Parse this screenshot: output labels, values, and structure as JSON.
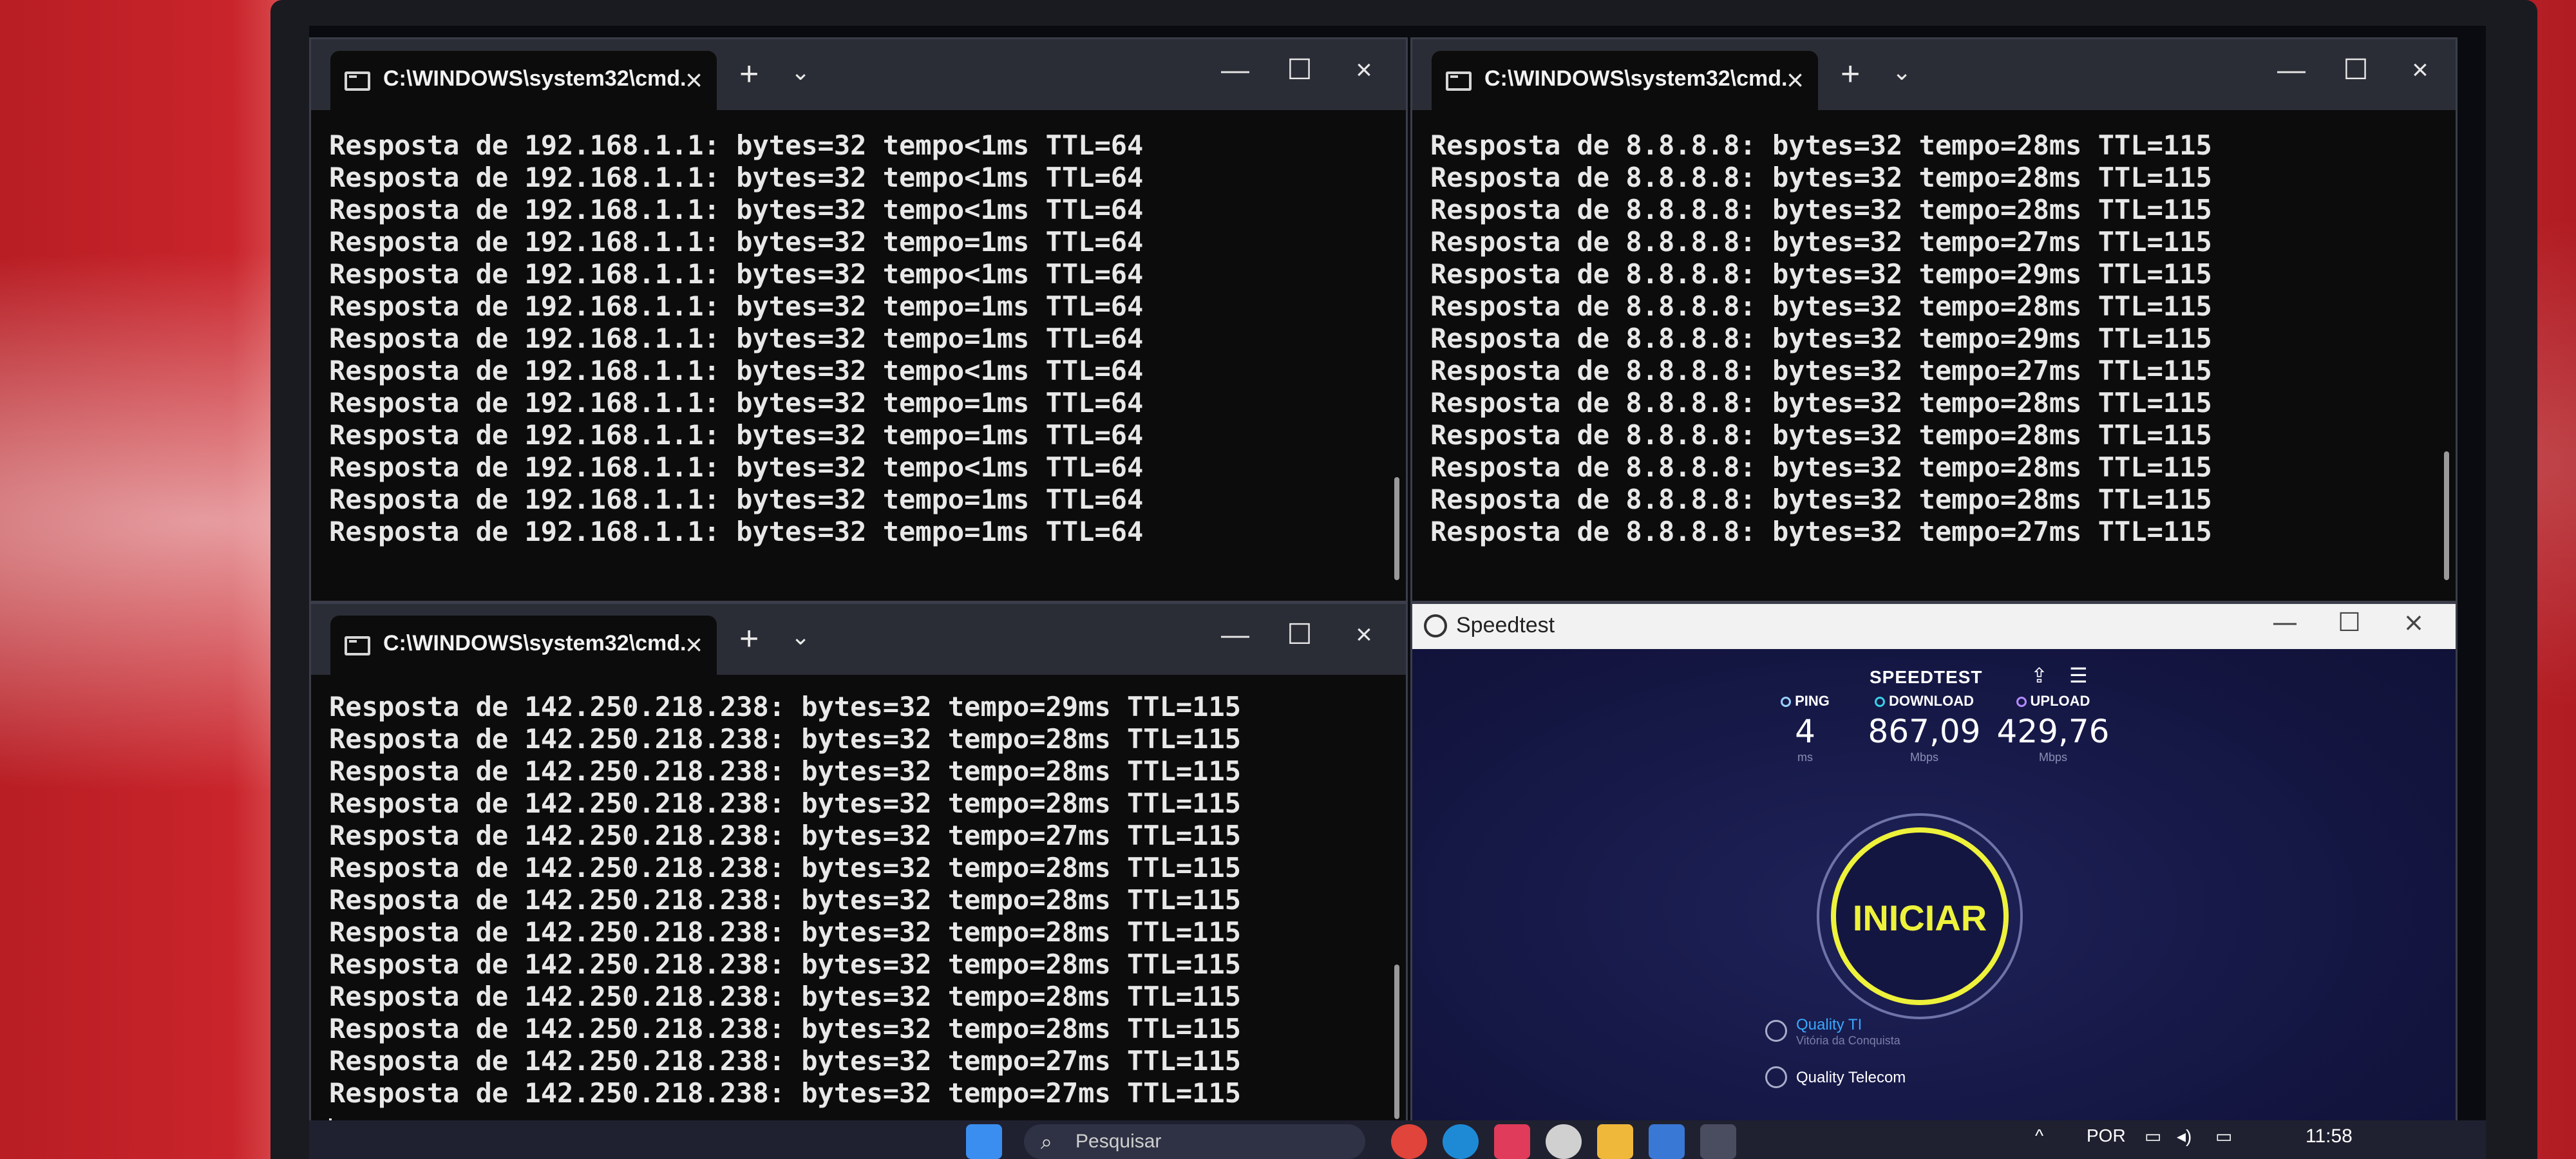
{
  "terminal_top_left": {
    "tab_title": "C:\\WINDOWS\\system32\\cmd.",
    "lines": [
      "Resposta de 192.168.1.1: bytes=32 tempo<1ms TTL=64",
      "Resposta de 192.168.1.1: bytes=32 tempo<1ms TTL=64",
      "Resposta de 192.168.1.1: bytes=32 tempo<1ms TTL=64",
      "Resposta de 192.168.1.1: bytes=32 tempo=1ms TTL=64",
      "Resposta de 192.168.1.1: bytes=32 tempo<1ms TTL=64",
      "Resposta de 192.168.1.1: bytes=32 tempo=1ms TTL=64",
      "Resposta de 192.168.1.1: bytes=32 tempo=1ms TTL=64",
      "Resposta de 192.168.1.1: bytes=32 tempo<1ms TTL=64",
      "Resposta de 192.168.1.1: bytes=32 tempo=1ms TTL=64",
      "Resposta de 192.168.1.1: bytes=32 tempo=1ms TTL=64",
      "Resposta de 192.168.1.1: bytes=32 tempo<1ms TTL=64",
      "Resposta de 192.168.1.1: bytes=32 tempo=1ms TTL=64",
      "Resposta de 192.168.1.1: bytes=32 tempo=1ms TTL=64"
    ]
  },
  "terminal_top_right": {
    "tab_title": "C:\\WINDOWS\\system32\\cmd.",
    "lines": [
      "Resposta de 8.8.8.8: bytes=32 tempo=28ms TTL=115",
      "Resposta de 8.8.8.8: bytes=32 tempo=28ms TTL=115",
      "Resposta de 8.8.8.8: bytes=32 tempo=28ms TTL=115",
      "Resposta de 8.8.8.8: bytes=32 tempo=27ms TTL=115",
      "Resposta de 8.8.8.8: bytes=32 tempo=29ms TTL=115",
      "Resposta de 8.8.8.8: bytes=32 tempo=28ms TTL=115",
      "Resposta de 8.8.8.8: bytes=32 tempo=29ms TTL=115",
      "Resposta de 8.8.8.8: bytes=32 tempo=27ms TTL=115",
      "Resposta de 8.8.8.8: bytes=32 tempo=28ms TTL=115",
      "Resposta de 8.8.8.8: bytes=32 tempo=28ms TTL=115",
      "Resposta de 8.8.8.8: bytes=32 tempo=28ms TTL=115",
      "Resposta de 8.8.8.8: bytes=32 tempo=28ms TTL=115",
      "Resposta de 8.8.8.8: bytes=32 tempo=27ms TTL=115"
    ]
  },
  "terminal_bottom_left": {
    "tab_title": "C:\\WINDOWS\\system32\\cmd.",
    "lines": [
      "Resposta de 142.250.218.238: bytes=32 tempo=29ms TTL=115",
      "Resposta de 142.250.218.238: bytes=32 tempo=28ms TTL=115",
      "Resposta de 142.250.218.238: bytes=32 tempo=28ms TTL=115",
      "Resposta de 142.250.218.238: bytes=32 tempo=28ms TTL=115",
      "Resposta de 142.250.218.238: bytes=32 tempo=27ms TTL=115",
      "Resposta de 142.250.218.238: bytes=32 tempo=28ms TTL=115",
      "Resposta de 142.250.218.238: bytes=32 tempo=28ms TTL=115",
      "Resposta de 142.250.218.238: bytes=32 tempo=28ms TTL=115",
      "Resposta de 142.250.218.238: bytes=32 tempo=28ms TTL=115",
      "Resposta de 142.250.218.238: bytes=32 tempo=28ms TTL=115",
      "Resposta de 142.250.218.238: bytes=32 tempo=28ms TTL=115",
      "Resposta de 142.250.218.238: bytes=32 tempo=27ms TTL=115",
      "Resposta de 142.250.218.238: bytes=32 tempo=27ms TTL=115"
    ]
  },
  "speedtest": {
    "window_title": "Speedtest",
    "brand": "SPEEDTEST",
    "ping": {
      "label": "PING",
      "value": "4",
      "unit": "ms"
    },
    "download": {
      "label": "DOWNLOAD",
      "value": "867,09",
      "unit": "Mbps"
    },
    "upload": {
      "label": "UPLOAD",
      "value": "429,76",
      "unit": "Mbps"
    },
    "go_label": "INICIAR",
    "server_name": "Quality TI",
    "server_location": "Vitória da Conquista",
    "provider": "Quality Telecom",
    "colors": {
      "accent": "#eef23a",
      "ping": "#9ad0ff",
      "download": "#39d0e8",
      "upload": "#b48cff"
    }
  },
  "taskbar": {
    "search_placeholder": "Pesquisar",
    "language": "POR",
    "time": "11:58"
  },
  "icons": {
    "close": "×",
    "add": "+",
    "dropdown": "⌄",
    "minimize": "—",
    "maximize": "☐",
    "search": "⌕"
  }
}
